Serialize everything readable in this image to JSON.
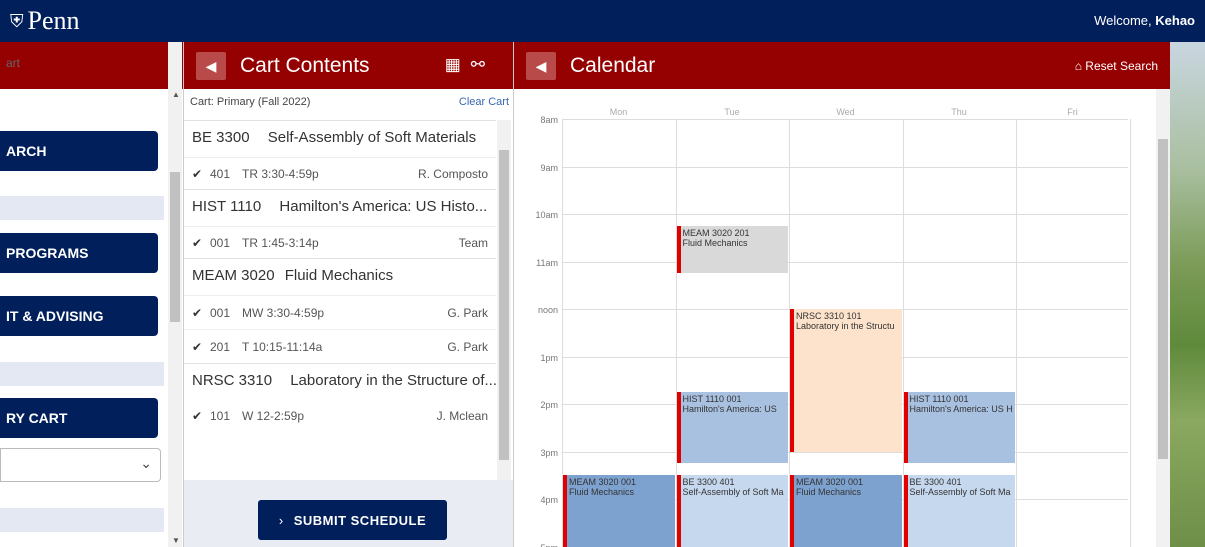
{
  "header": {
    "logo": "Penn",
    "welcome_prefix": "Welcome,",
    "user": "Kehao"
  },
  "left": {
    "crumb": "art",
    "buttons": [
      "ARCH",
      "PROGRAMS",
      "IT & ADVISING",
      "RY CART"
    ]
  },
  "cart": {
    "title": "Cart Contents",
    "subtitle": "Cart: Primary (Fall 2022)",
    "clear": "Clear Cart",
    "submit": "SUBMIT SCHEDULE",
    "courses": [
      {
        "code": "BE 3300",
        "name": "Self-Assembly of Soft Materials",
        "sections": [
          {
            "num": "401",
            "time": "TR 3:30-4:59p",
            "instructor": "R. Composto"
          }
        ]
      },
      {
        "code": "HIST 1110",
        "name": "Hamilton's America: US Histo...",
        "sections": [
          {
            "num": "001",
            "time": "TR 1:45-3:14p",
            "instructor": "Team"
          }
        ]
      },
      {
        "code": "MEAM 3020",
        "name": "Fluid Mechanics",
        "sections": [
          {
            "num": "001",
            "time": "MW 3:30-4:59p",
            "instructor": "G. Park"
          },
          {
            "num": "201",
            "time": "T 10:15-11:14a",
            "instructor": "G. Park"
          }
        ]
      },
      {
        "code": "NRSC 3310",
        "name": "Laboratory in the Structure of...",
        "sections": [
          {
            "num": "101",
            "time": "W 12-2:59p",
            "instructor": "J. Mclean"
          }
        ]
      }
    ]
  },
  "calendar": {
    "title": "Calendar",
    "reset": "Reset Search",
    "days": [
      "Mon",
      "Tue",
      "Wed",
      "Thu",
      "Fri"
    ],
    "hours": [
      "8am",
      "9am",
      "10am",
      "11am",
      "noon",
      "1pm",
      "2pm",
      "3pm",
      "4pm",
      "5pm"
    ],
    "events": [
      {
        "day": 1,
        "start": 10.25,
        "end": 11.25,
        "line1": "MEAM 3020 201",
        "line2": "Fluid Mechanics",
        "color": "#d9d9d9"
      },
      {
        "day": 2,
        "start": 12.0,
        "end": 15.0,
        "line1": "NRSC 3310 101",
        "line2": "Laboratory in the Structu",
        "color": "#fde3cc"
      },
      {
        "day": 1,
        "start": 13.75,
        "end": 15.25,
        "line1": "HIST 1110 001",
        "line2": "Hamilton's America: US",
        "color": "#a9c1e0"
      },
      {
        "day": 3,
        "start": 13.75,
        "end": 15.25,
        "line1": "HIST 1110 001",
        "line2": "Hamilton's America: US H",
        "color": "#a9c1e0"
      },
      {
        "day": 0,
        "start": 15.5,
        "end": 17.0,
        "line1": "MEAM 3020 001",
        "line2": "Fluid Mechanics",
        "color": "#7da2cf"
      },
      {
        "day": 1,
        "start": 15.5,
        "end": 17.0,
        "line1": "BE 3300 401",
        "line2": "Self-Assembly of Soft Ma",
        "color": "#c6d8ee"
      },
      {
        "day": 2,
        "start": 15.5,
        "end": 17.0,
        "line1": "MEAM 3020 001",
        "line2": "Fluid Mechanics",
        "color": "#7da2cf"
      },
      {
        "day": 3,
        "start": 15.5,
        "end": 17.0,
        "line1": "BE 3300 401",
        "line2": "Self-Assembly of Soft Ma",
        "color": "#c6d8ee"
      }
    ]
  },
  "icons": {
    "collapse": "caret-left-icon",
    "calendar": "calendar-icon",
    "link": "link-icon",
    "home": "home-icon",
    "check": "check-icon",
    "chevron": "chevron-down-icon",
    "submit_arrow": "chevron-right-icon"
  }
}
